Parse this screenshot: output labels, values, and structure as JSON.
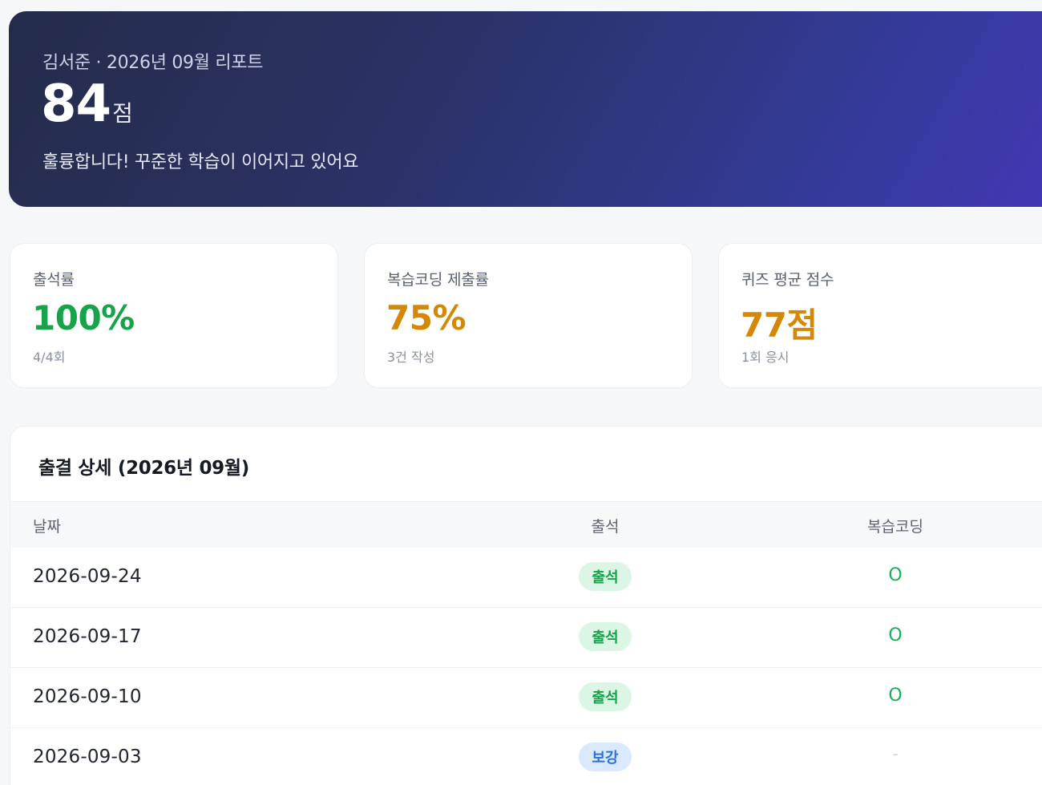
{
  "hero": {
    "subtitle": "김서준 · 2026년 09월 리포트",
    "score": "84",
    "score_unit": "점",
    "message": "훌륭합니다! 꾸준한 학습이 이어지고 있어요"
  },
  "stats": [
    {
      "label": "출석률",
      "value": "100%",
      "note": "4/4회",
      "color": "#16a34a"
    },
    {
      "label": "복습코딩 제출률",
      "value": "75%",
      "note": "3건 작성",
      "color": "#d48806"
    },
    {
      "label": "퀴즈 평균 점수",
      "value": "77점",
      "note": "1회 응시",
      "color": "#d48806"
    }
  ],
  "attendance": {
    "title": "출결 상세 (2026년 09월)",
    "columns": [
      "날짜",
      "출석",
      "복습코딩"
    ],
    "rows": [
      {
        "date": "2026-09-24",
        "status": "출석",
        "review": "O"
      },
      {
        "date": "2026-09-17",
        "status": "출석",
        "review": "O"
      },
      {
        "date": "2026-09-10",
        "status": "출석",
        "review": "O"
      },
      {
        "date": "2026-09-03",
        "status": "보강",
        "review": "-"
      }
    ]
  },
  "colors": {
    "present_badge_bg": "#dcf6e5",
    "present_badge_text": "#15a34a",
    "makeup_badge_bg": "#dbe9ff",
    "makeup_badge_text": "#2f6fe0",
    "review_ok": "#16b157"
  }
}
